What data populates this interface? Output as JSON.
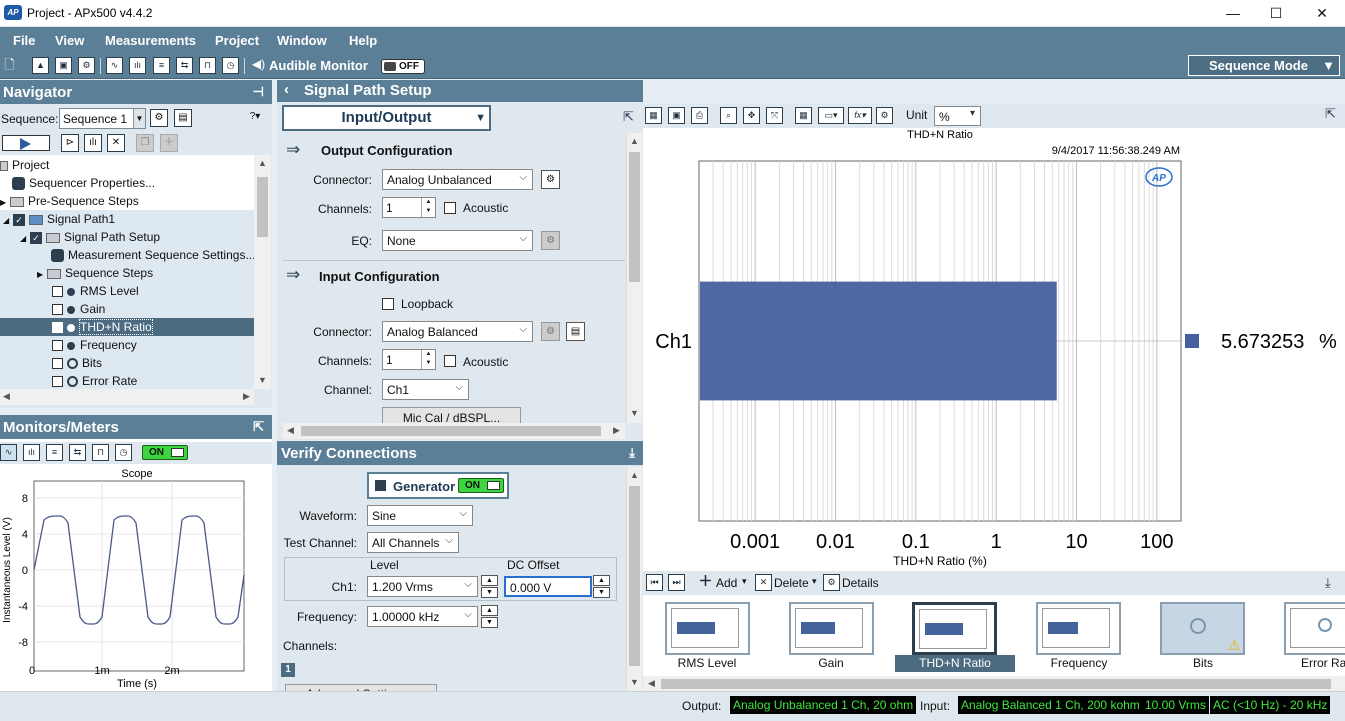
{
  "window": {
    "title": "Project - APx500 v4.4.2",
    "logo_text": "AP",
    "minimize": "—",
    "maximize": "☐",
    "close": "✕"
  },
  "menu": [
    "File",
    "View",
    "Measurements",
    "Project",
    "Window",
    "Help"
  ],
  "toolbar": {
    "audible_monitor": "Audible Monitor",
    "audible_state": "OFF",
    "mode": "Sequence Mode"
  },
  "navigator": {
    "title": "Navigator",
    "sequence_label": "Sequence:",
    "sequence_value": "Sequence 1",
    "tree": [
      {
        "label": "Project"
      },
      {
        "label": "Sequencer Properties..."
      },
      {
        "label": "Pre-Sequence Steps"
      },
      {
        "label": "Signal Path1"
      },
      {
        "label": "Signal Path Setup"
      },
      {
        "label": "Measurement Sequence Settings..."
      },
      {
        "label": "Sequence Steps"
      },
      {
        "label": "RMS Level"
      },
      {
        "label": "Gain"
      },
      {
        "label": "THD+N Ratio"
      },
      {
        "label": "Frequency"
      },
      {
        "label": "Bits"
      },
      {
        "label": "Error Rate"
      }
    ]
  },
  "monitors": {
    "title": "Monitors/Meters",
    "on_label": "ON",
    "scope": {
      "title": "Scope",
      "ylabel": "Instantaneous Level (V)",
      "xlabel": "Time (s)",
      "yticks": [
        "8",
        "4",
        "0",
        "-4",
        "-8"
      ],
      "xticks": [
        "0",
        "1m",
        "2m"
      ]
    }
  },
  "signal_path": {
    "title": "Signal Path Setup",
    "mode_button": "Input/Output",
    "output_config": {
      "title": "Output Configuration",
      "connector_label": "Connector:",
      "connector": "Analog Unbalanced",
      "channels_label": "Channels:",
      "channels": "1",
      "acoustic": "Acoustic",
      "eq_label": "EQ:",
      "eq": "None"
    },
    "input_config": {
      "title": "Input Configuration",
      "loopback": "Loopback",
      "connector_label": "Connector:",
      "connector": "Analog Balanced",
      "channels_label": "Channels:",
      "channels": "1",
      "acoustic": "Acoustic",
      "channel_label": "Channel:",
      "channel": "Ch1",
      "mic_cal": "Mic Cal / dBSPL..."
    }
  },
  "verify": {
    "title": "Verify Connections",
    "generator": "Generator",
    "generator_state": "ON",
    "waveform_label": "Waveform:",
    "waveform": "Sine",
    "test_channel_label": "Test Channel:",
    "test_channel": "All Channels",
    "level_header": "Level",
    "dc_header": "DC Offset",
    "ch1_label": "Ch1:",
    "level": "1.200 Vrms",
    "dc_offset": "0.000 V",
    "frequency_label": "Frequency:",
    "frequency": "1.00000 kHz",
    "channels_label": "Channels:",
    "channel_badge": "1",
    "advanced": "Advanced Settings..."
  },
  "graph": {
    "unit_label": "Unit",
    "unit": "%",
    "title": "THD+N Ratio",
    "timestamp": "9/4/2017 11:56:38.249 AM",
    "logo": "AP"
  },
  "chart_data": {
    "type": "bar",
    "orientation": "horizontal",
    "title": "THD+N Ratio",
    "xlabel": "THD+N Ratio (%)",
    "categories": [
      "Ch1"
    ],
    "values": [
      5.673253
    ],
    "value_label": "5.673253",
    "value_unit": "%",
    "xscale": "log",
    "xlim": [
      0.0002,
      200
    ],
    "xticks": [
      "0.001",
      "0.01",
      "0.1",
      "1",
      "10",
      "100"
    ],
    "grid": true,
    "color": "#44609e"
  },
  "results_toolbar": {
    "add": "Add",
    "delete": "Delete",
    "details": "Details"
  },
  "thumbnails": [
    "RMS Level",
    "Gain",
    "THD+N Ratio",
    "Frequency",
    "Bits",
    "Error Rat"
  ],
  "status": {
    "output_label": "Output:",
    "output": "Analog Unbalanced 1 Ch, 20 ohm",
    "input_label": "Input:",
    "input": "Analog Balanced 1 Ch, 200 kohm",
    "range": "10.00 Vrms",
    "filter": "AC (<10 Hz) - 20 kHz"
  },
  "colors": {
    "accent": "#5a7f96",
    "selection": "#4c6b80",
    "bar": "#44609e",
    "on": "#3ed63e"
  }
}
